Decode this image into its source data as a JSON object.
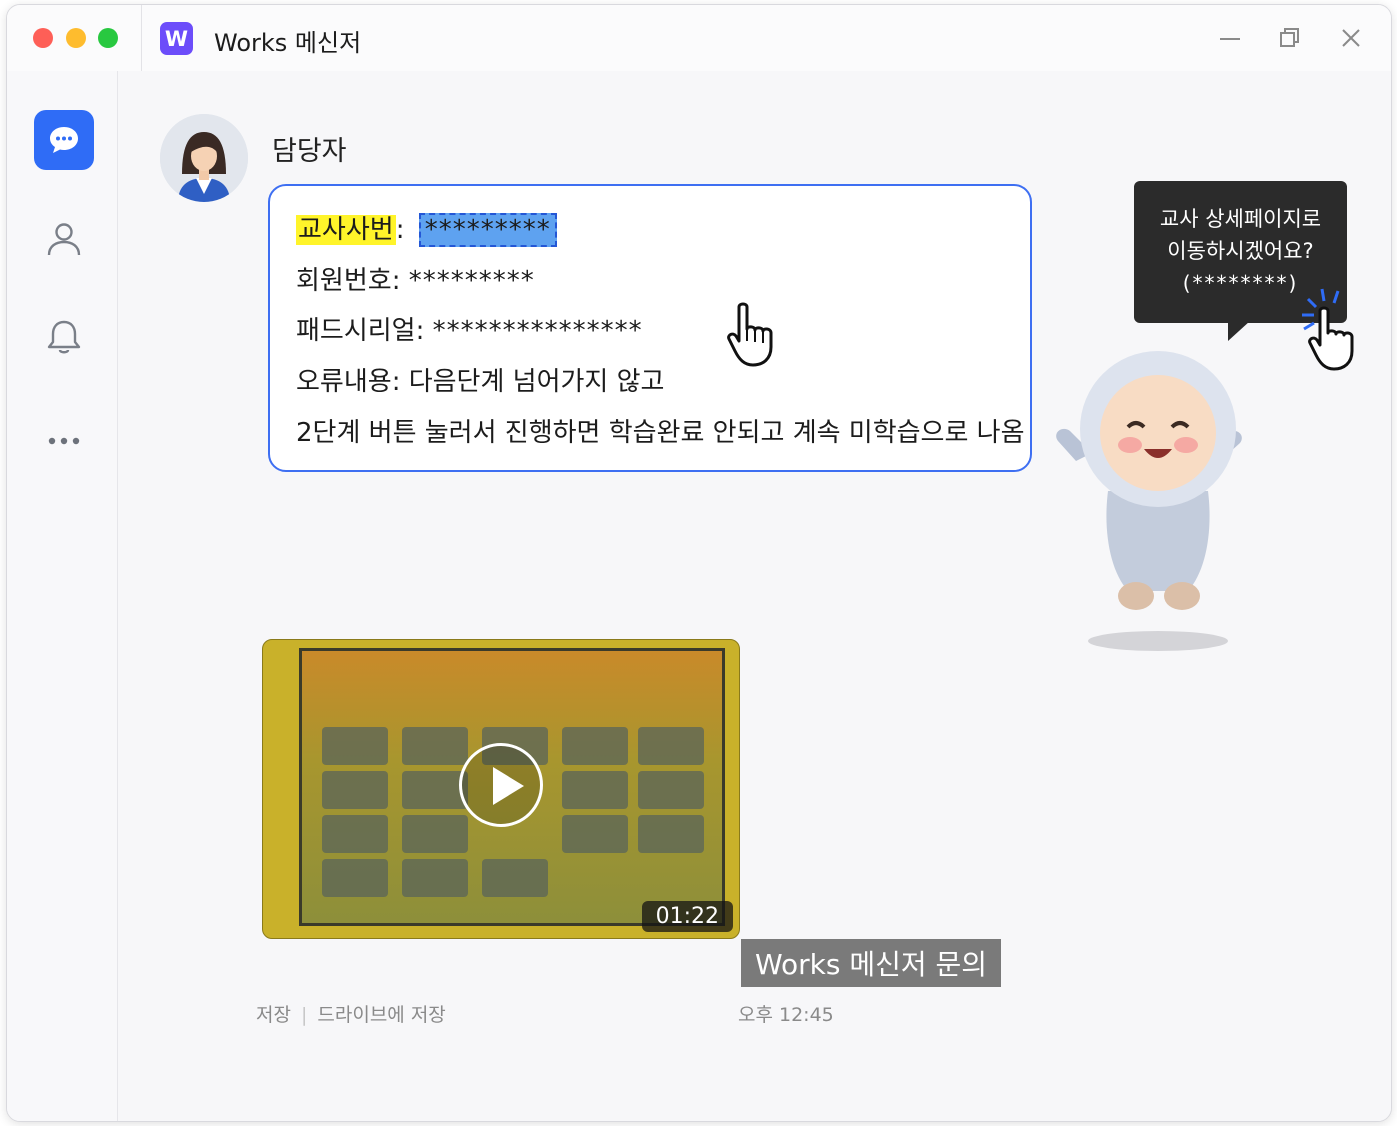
{
  "window": {
    "title": "Works 메신저",
    "app_icon_letter": "W",
    "accent_color": "#2f6cf6"
  },
  "sidebar": {
    "items": [
      {
        "name": "chat",
        "icon": "chat-bubble-icon",
        "active": true
      },
      {
        "name": "contacts",
        "icon": "person-icon",
        "active": false
      },
      {
        "name": "notifications",
        "icon": "bell-icon",
        "active": false
      },
      {
        "name": "more",
        "icon": "more-dots-icon",
        "active": false
      }
    ]
  },
  "message": {
    "sender": "담당자",
    "lines": [
      {
        "label": "교사사번",
        "value": "*********"
      },
      {
        "label": "회원번호",
        "value": "*********"
      },
      {
        "label": "패드시리얼",
        "value": "***************"
      },
      {
        "label": "오류내용",
        "value": "다음단계 넘어가지 않고"
      },
      {
        "text": "2단계 버튼 눌러서 진행하면 학습완료 안되고 계속 미학습으로 나옴"
      }
    ]
  },
  "tooltip": {
    "line1": "교사 상세페이지로",
    "line2": "이동하시겠어요?",
    "line3": "(********)"
  },
  "video": {
    "duration": "01:22",
    "caption": "Works 메신저 문의"
  },
  "footer": {
    "save_label": "저장",
    "drive_save_label": "드라이브에 저장",
    "time": "오후 12:45"
  }
}
